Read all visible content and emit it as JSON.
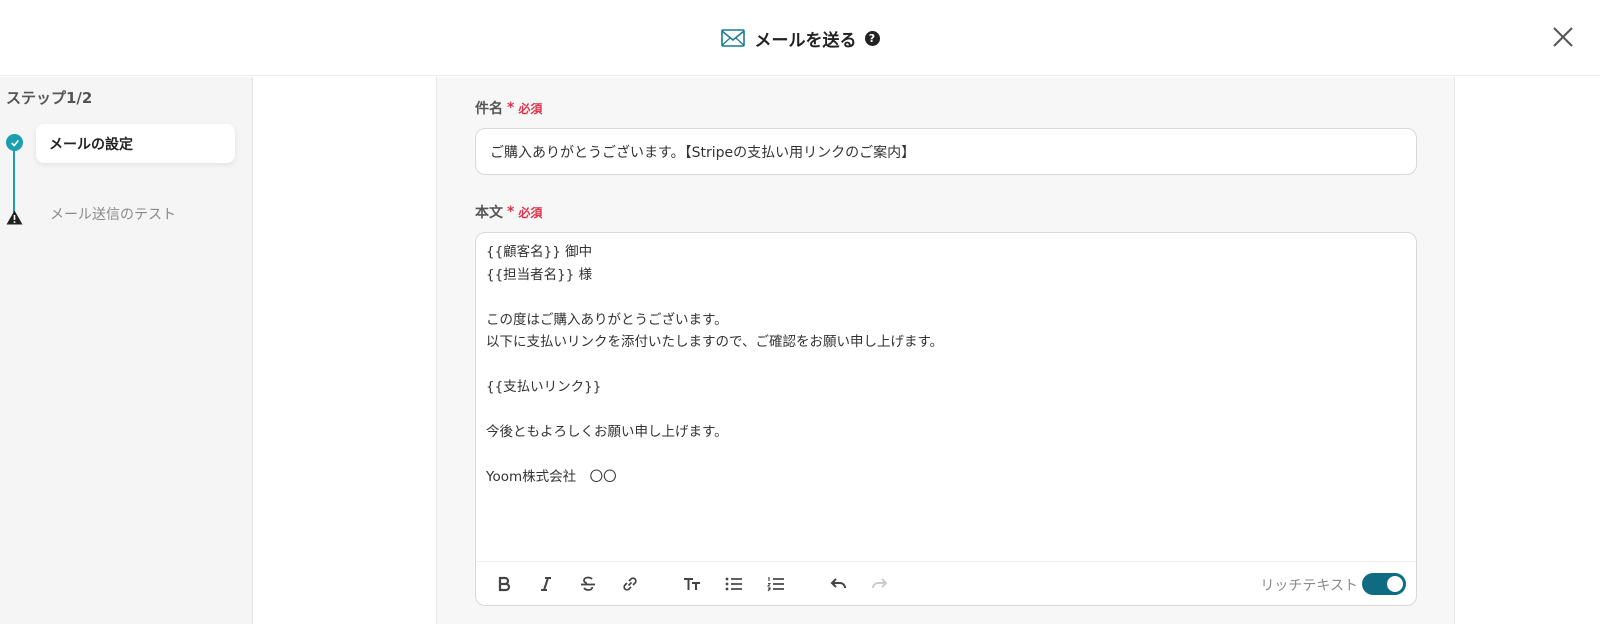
{
  "header": {
    "title": "メールを送る",
    "help_glyph": "?",
    "icons": {
      "mail": "mail-icon",
      "help": "help-icon",
      "close": "close-icon"
    }
  },
  "sidebar": {
    "step_label": "ステップ1/2",
    "steps": [
      {
        "label": "メールの設定",
        "status": "complete",
        "icon": "check-icon"
      },
      {
        "label": "メール送信のテスト",
        "status": "warning",
        "icon": "warning-icon"
      }
    ]
  },
  "form": {
    "subject": {
      "label": "件名",
      "required_mark": "*",
      "required_text": "必須",
      "value": "ご購入ありがとうございます。【Stripeの支払い用リンクのご案内】"
    },
    "body": {
      "label": "本文",
      "required_mark": "*",
      "required_text": "必須",
      "value": "{{顧客名}} 御中\n{{担当者名}} 様\n\nこの度はご購入ありがとうございます。\n以下に支払いリンクを添付いたしますので、ご確認をお願い申し上げます。\n\n{{支払いリンク}}\n\n今後ともよろしくお願い申し上げます。\n\nYoom株式会社　〇〇"
    },
    "toolbar": {
      "buttons": [
        "bold-icon",
        "italic-icon",
        "strikethrough-icon",
        "link-icon",
        "text-size-icon",
        "bullet-list-icon",
        "numbered-list-icon",
        "undo-icon",
        "redo-icon"
      ],
      "rich_text_label": "リッチテキスト",
      "rich_text_enabled": true
    }
  },
  "colors": {
    "accent": "#1a9fb0",
    "toggle": "#0f6b82",
    "required": "#e0344a"
  }
}
